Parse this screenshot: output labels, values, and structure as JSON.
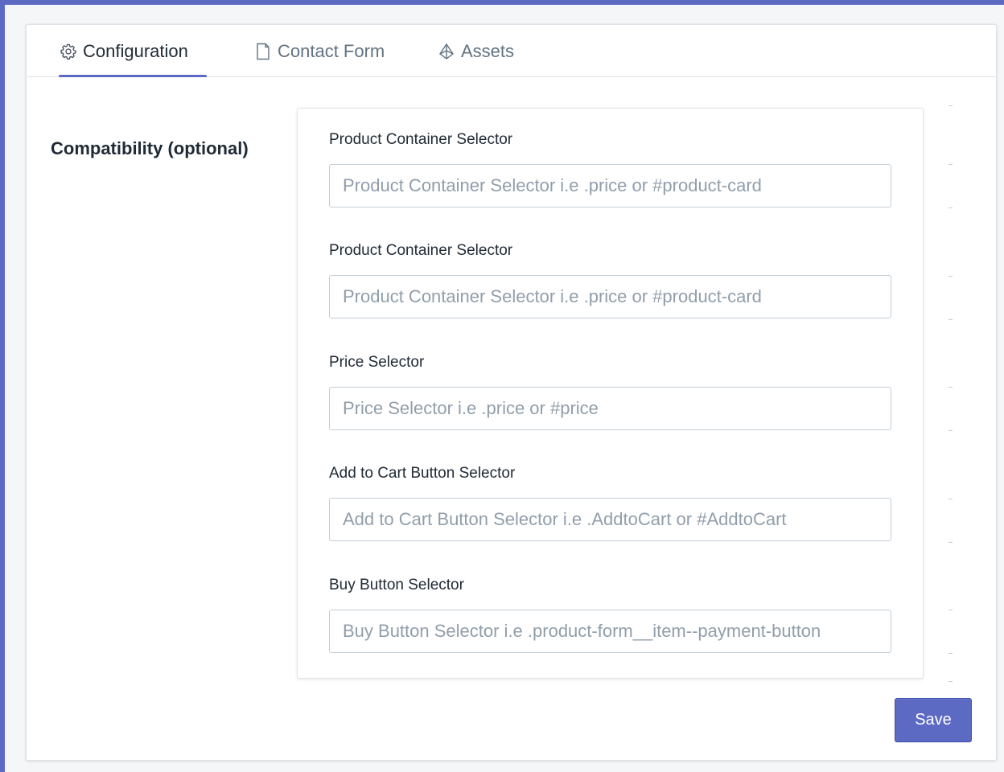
{
  "tabs": [
    {
      "label": "Configuration",
      "icon": "gear-icon",
      "active": true
    },
    {
      "label": "Contact Form",
      "icon": "page-icon",
      "active": false
    },
    {
      "label": "Assets",
      "icon": "assets-icon",
      "active": false
    }
  ],
  "section": {
    "title": "Compatibility (optional)"
  },
  "fields": [
    {
      "label": "Product Container Selector",
      "placeholder": "Product Container Selector i.e .price or #product-card",
      "value": ""
    },
    {
      "label": "Product Container Selector",
      "placeholder": "Product Container Selector i.e .price or #product-card",
      "value": ""
    },
    {
      "label": "Price Selector",
      "placeholder": "Price Selector i.e .price or #price",
      "value": ""
    },
    {
      "label": "Add to Cart Button Selector",
      "placeholder": "Add to Cart Button Selector i.e .AddtoCart or #AddtoCart",
      "value": ""
    },
    {
      "label": "Buy Button Selector",
      "placeholder": "Buy Button Selector i.e .product-form__item--payment-button",
      "value": ""
    }
  ],
  "actions": {
    "save_label": "Save"
  },
  "colors": {
    "accent": "#5c6ac4",
    "border": "#dfe3e8",
    "text": "#212b36",
    "placeholder": "#919eab"
  }
}
